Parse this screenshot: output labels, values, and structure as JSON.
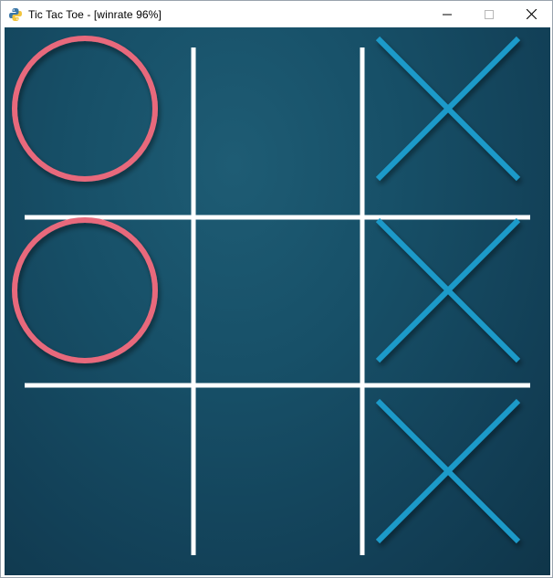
{
  "window": {
    "title": "Tic Tac Toe - [winrate 96%]",
    "app_icon": "python-icon",
    "controls": [
      "minimize-icon",
      "maximize-icon",
      "close-icon"
    ]
  },
  "game": {
    "board": [
      [
        "O",
        "",
        "X"
      ],
      [
        "O",
        "",
        "X"
      ],
      [
        "",
        "",
        "X"
      ]
    ],
    "winrate_percent": 96,
    "colors": {
      "background": "#164a62",
      "grid": "#ffffff",
      "o_mark": "#e8697b",
      "x_mark": "#1e9ac9"
    }
  }
}
